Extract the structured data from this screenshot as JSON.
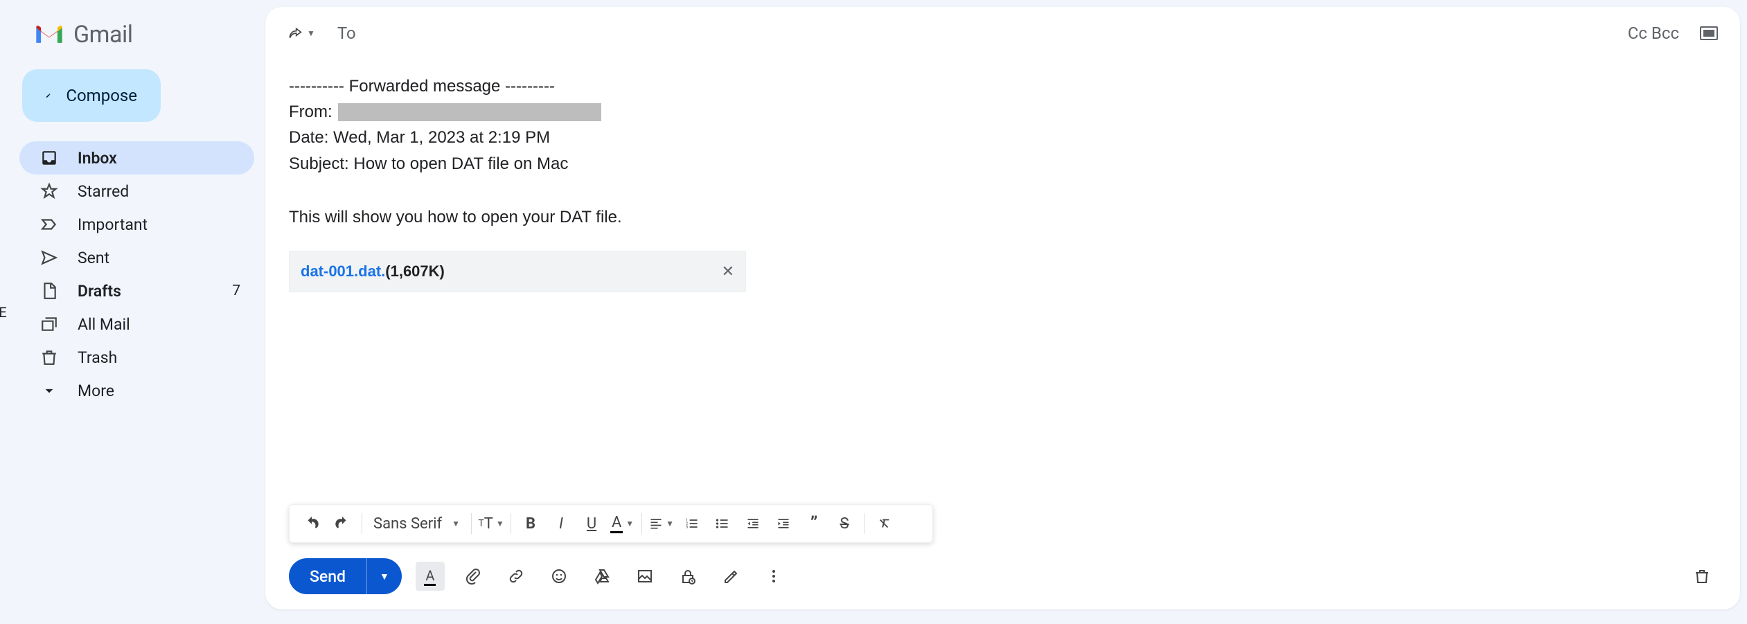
{
  "logo": {
    "text": "Gmail"
  },
  "compose_label": "Compose",
  "nav": {
    "inbox": "Inbox",
    "starred": "Starred",
    "important": "Important",
    "sent": "Sent",
    "drafts": "Drafts",
    "drafts_count": "7",
    "allmail": "All Mail",
    "trash": "Trash",
    "more": "More"
  },
  "to_row": {
    "to": "To",
    "cc": "Cc",
    "bcc": "Bcc"
  },
  "fwd": {
    "divider": "---------- Forwarded message ---------",
    "from_label": "From:",
    "date_line": "Date: Wed, Mar 1, 2023 at 2:19 PM",
    "subject_line": "Subject: How to open DAT file on Mac"
  },
  "body_text": "This will show you how to open your DAT file.",
  "attachment": {
    "name": "dat-001.dat.",
    "size": "(1,607K)"
  },
  "format": {
    "font": "Sans Serif"
  },
  "send": "Send"
}
